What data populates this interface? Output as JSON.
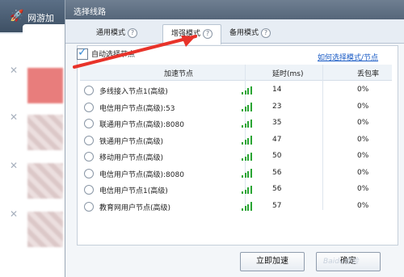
{
  "background_app": {
    "title": "网游加",
    "row_count": 4
  },
  "dialog": {
    "title": "选择线路",
    "tabs": [
      {
        "label": "通用模式",
        "help": "?"
      },
      {
        "label": "增强模式",
        "help": "?"
      },
      {
        "label": "备用模式",
        "help": "?"
      }
    ],
    "active_tab": 1,
    "auto_select": {
      "checked": true,
      "label": "自动选择节点"
    },
    "help_link": "如何选择模式/节点",
    "columns": {
      "node": "加速节点",
      "latency": "延时(ms)",
      "loss": "丢包率"
    },
    "nodes": [
      {
        "name": "多线接入节点1(高级)",
        "signal_bars": 4,
        "latency": "14",
        "loss": "0%"
      },
      {
        "name": "电信用户节点(高级):53",
        "signal_bars": 4,
        "latency": "23",
        "loss": "0%"
      },
      {
        "name": "联通用户节点(高级):8080",
        "signal_bars": 4,
        "latency": "35",
        "loss": "0%"
      },
      {
        "name": "铁通用户节点(高级)",
        "signal_bars": 4,
        "latency": "47",
        "loss": "0%"
      },
      {
        "name": "移动用户节点(高级)",
        "signal_bars": 4,
        "latency": "50",
        "loss": "0%"
      },
      {
        "name": "电信用户节点(高级):8080",
        "signal_bars": 4,
        "latency": "56",
        "loss": "0%"
      },
      {
        "name": "电信用户节点1(高级)",
        "signal_bars": 4,
        "latency": "56",
        "loss": "0%"
      },
      {
        "name": "教育网用户节点(高级)",
        "signal_bars": 4,
        "latency": "57",
        "loss": "0%"
      }
    ],
    "buttons": {
      "accelerate": "立即加速",
      "ok": "确定"
    }
  },
  "watermark": "Baidu经验",
  "colors": {
    "signal": "#2aa534",
    "link": "#1a5bc5",
    "arrow": "#e8332a",
    "check": "#3c8dd6"
  }
}
